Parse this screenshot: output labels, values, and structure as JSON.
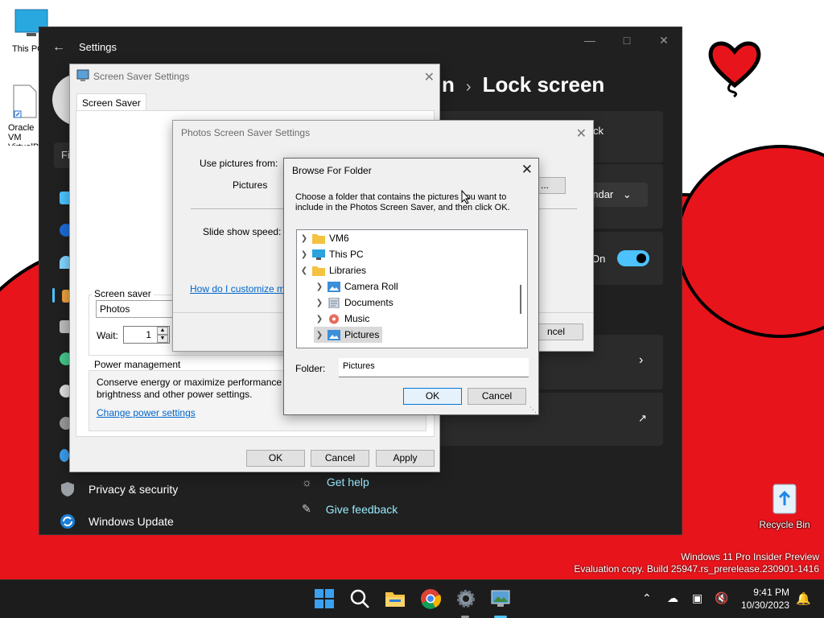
{
  "desktop": {
    "icons": [
      {
        "label": "This PC"
      },
      {
        "label": "Oracle VM VirtualBox"
      },
      {
        "label": "Recycle Bin"
      }
    ],
    "watermark": {
      "line1": "Windows 11 Pro Insider Preview",
      "line2": "Evaluation copy. Build 25947.rs_prerelease.230901-1416"
    }
  },
  "settings": {
    "title": "Settings",
    "find_placeholder": "Fi",
    "breadcrumb_left": "n",
    "breadcrumb_page": "Lock screen",
    "card_partial_1": "ck",
    "card_dropdown": "endar",
    "toggle_label": "On",
    "nav": [
      {
        "label": "Privacy & security",
        "icon": "shield-icon"
      },
      {
        "label": "Windows Update",
        "icon": "windows-update-icon"
      }
    ],
    "help_links": [
      {
        "label": "Get help"
      },
      {
        "label": "Give feedback"
      }
    ]
  },
  "screensaver_dialog": {
    "title": "Screen Saver Settings",
    "tab": "Screen Saver",
    "group_label": "Screen saver",
    "saver_value": "Photos",
    "wait_label": "Wait:",
    "wait_value": "1",
    "power_group_label": "Power management",
    "power_text": "Conserve energy or maximize performance b brightness and other power settings.",
    "power_text_line1": "Conserve energy or maximize performance b",
    "power_text_line2": "brightness and other power settings.",
    "power_link": "Change power settings",
    "buttons": {
      "ok": "OK",
      "cancel": "Cancel",
      "apply": "Apply"
    }
  },
  "photos_dialog": {
    "title": "Photos Screen Saver Settings",
    "use_pictures_label": "Use pictures from:",
    "pictures_value": "Pictures",
    "slide_speed_label": "Slide show speed:",
    "help_link": "How do I customize m",
    "browse_partial": "...",
    "cancel_partial": "ncel"
  },
  "browse_dialog": {
    "title": "Browse For Folder",
    "description": "Choose a folder that contains the pictures you want to include in the Photos Screen Saver, and then click OK.",
    "description_line1": "Choose a folder that contains the pictures you want to",
    "description_line2": "include in the Photos Screen Saver, and then click OK.",
    "tree": [
      {
        "label": "VM6",
        "icon": "folder-icon",
        "level": 0,
        "expander": "collapsed"
      },
      {
        "label": "This PC",
        "icon": "computer-icon",
        "level": 0,
        "expander": "collapsed"
      },
      {
        "label": "Libraries",
        "icon": "folder-icon",
        "level": 0,
        "expander": "expanded"
      },
      {
        "label": "Camera Roll",
        "icon": "pictures-icon",
        "level": 1,
        "expander": "collapsed"
      },
      {
        "label": "Documents",
        "icon": "documents-icon",
        "level": 1,
        "expander": "collapsed"
      },
      {
        "label": "Music",
        "icon": "music-icon",
        "level": 1,
        "expander": "collapsed"
      },
      {
        "label": "Pictures",
        "icon": "pictures-icon",
        "level": 1,
        "expander": "collapsed",
        "selected": true
      }
    ],
    "folder_label": "Folder:",
    "folder_value": "Pictures",
    "ok": "OK",
    "cancel": "Cancel"
  },
  "taskbar": {
    "apps": [
      "start-icon",
      "search-icon",
      "file-explorer-icon",
      "chrome-icon",
      "settings-icon",
      "screensaver-app-icon"
    ],
    "time": "9:41 PM",
    "date": "10/30/2023"
  },
  "colors": {
    "accent": "#0078d7",
    "wallpaper_red": "#e8141b",
    "settings_bg": "#202020",
    "toggle_on": "#4cc2ff",
    "link_blue": "#0066cc"
  }
}
